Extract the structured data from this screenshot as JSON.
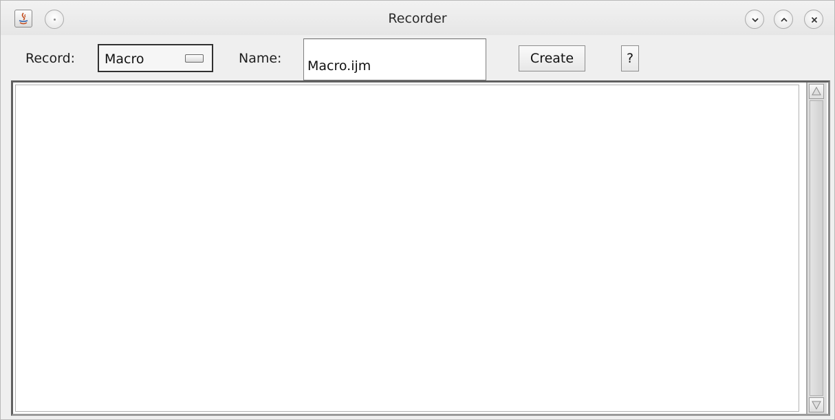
{
  "window": {
    "title": "Recorder",
    "icons": {
      "app": "java-app-icon",
      "menu": "window-menu-icon",
      "minimize": "minimize-icon",
      "maximize": "maximize-icon",
      "close": "close-icon"
    }
  },
  "toolbar": {
    "record_label": "Record:",
    "record_selected": "Macro",
    "name_label": "Name:",
    "name_value": "Macro.ijm",
    "create_label": "Create",
    "help_label": "?"
  },
  "editor": {
    "content": ""
  },
  "colors": {
    "window_bg": "#efefef",
    "text_area_bg": "#ffffff",
    "border_dark": "#303030"
  }
}
